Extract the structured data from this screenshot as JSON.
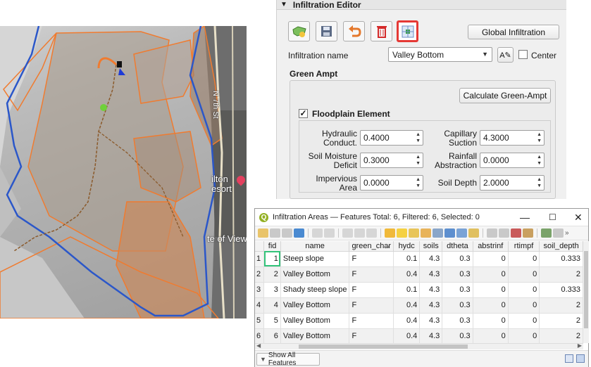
{
  "map": {
    "labels": {
      "ilton": "ilton",
      "esort": "esort",
      "view": "te of View",
      "street": "N 7th St"
    }
  },
  "editor": {
    "title": "Infiltration Editor",
    "tools": [
      "add-polygon-icon",
      "save-edits-icon",
      "revert-icon",
      "delete-icon",
      "area-select-icon"
    ],
    "global_button": "Global Infiltration",
    "name_label": "Infiltration name",
    "name_value": "Valley Bottom",
    "center_label": "Center",
    "method_title": "Green Ampt",
    "calc_button": "Calculate Green-Ampt",
    "floodplain_label": "Floodplain Element",
    "floodplain_checked": "✓",
    "params": {
      "hydc_label": "Hydraulic Conduct.",
      "hydc_value": "0.4000",
      "cap_label": "Capillary Suction",
      "cap_value": "4.3000",
      "smd_label": "Soil Moisture Deficit",
      "smd_value": "0.3000",
      "rain_label": "Rainfall Abstraction",
      "rain_value": "0.0000",
      "imp_label": "Impervious Area",
      "imp_value": "0.0000",
      "depth_label": "Soil Depth",
      "depth_value": "2.0000"
    }
  },
  "attr": {
    "title": "Infiltration Areas — Features Total: 6, Filtered: 6, Selected: 0",
    "columns": [
      "fid",
      "name",
      "green_char",
      "hydc",
      "soils",
      "dtheta",
      "abstrinf",
      "rtimpf",
      "soil_depth"
    ],
    "rows": [
      {
        "n": "1",
        "fid": "1",
        "name": "Steep slope",
        "green_char": "F",
        "hydc": "0.1",
        "soils": "4.3",
        "dtheta": "0.3",
        "abstrinf": "0",
        "rtimpf": "0",
        "soil_depth": "0.333"
      },
      {
        "n": "2",
        "fid": "2",
        "name": "Valley Bottom",
        "green_char": "F",
        "hydc": "0.4",
        "soils": "4.3",
        "dtheta": "0.3",
        "abstrinf": "0",
        "rtimpf": "0",
        "soil_depth": "2"
      },
      {
        "n": "3",
        "fid": "3",
        "name": "Shady steep slope",
        "green_char": "F",
        "hydc": "0.1",
        "soils": "4.3",
        "dtheta": "0.3",
        "abstrinf": "0",
        "rtimpf": "0",
        "soil_depth": "0.333"
      },
      {
        "n": "4",
        "fid": "4",
        "name": "Valley Bottom",
        "green_char": "F",
        "hydc": "0.4",
        "soils": "4.3",
        "dtheta": "0.3",
        "abstrinf": "0",
        "rtimpf": "0",
        "soil_depth": "2"
      },
      {
        "n": "5",
        "fid": "5",
        "name": "Valley Bottom",
        "green_char": "F",
        "hydc": "0.4",
        "soils": "4.3",
        "dtheta": "0.3",
        "abstrinf": "0",
        "rtimpf": "0",
        "soil_depth": "2"
      },
      {
        "n": "6",
        "fid": "6",
        "name": "Valley Bottom",
        "green_char": "F",
        "hydc": "0.4",
        "soils": "4.3",
        "dtheta": "0.3",
        "abstrinf": "0",
        "rtimpf": "0",
        "soil_depth": "2"
      }
    ],
    "show_all": "Show All Features"
  },
  "colors": {
    "boundary": "#2b57c9",
    "polygon": "#f07b2f",
    "highlight": "#e53935",
    "focus": "#33c37a"
  }
}
